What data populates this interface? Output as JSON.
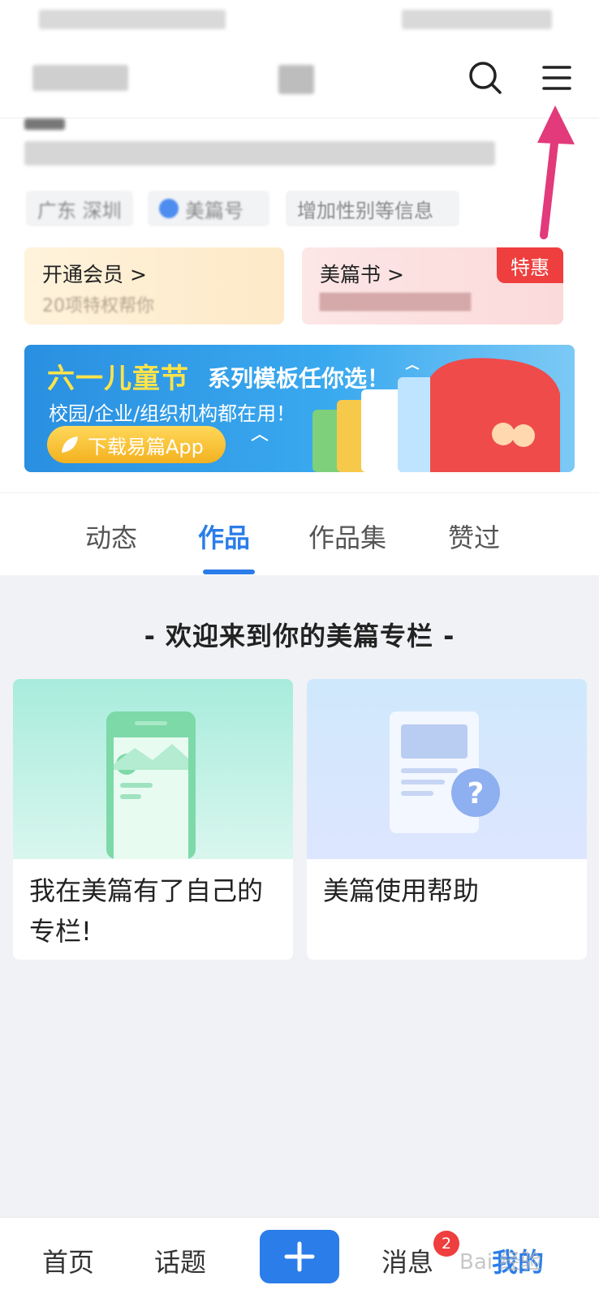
{
  "profile_card": {
    "member_title": "开通会员 >",
    "member_sub": "20项特权帮你",
    "book_title": "美篇书 >",
    "book_badge": "特惠",
    "tag_add_info": "增加性别等信息"
  },
  "banner": {
    "title": "六一儿童节",
    "title_rest": "系列模板任你选！",
    "line2": "校园/企业/组织机构都在用！",
    "button": "下载易篇App"
  },
  "tabs": [
    "动态",
    "作品",
    "作品集",
    "赞过"
  ],
  "content": {
    "welcome": "- 欢迎来到你的美篇专栏 -",
    "cards": [
      {
        "label": "我在美篇有了自己的专栏!"
      },
      {
        "label": "美篇使用帮助"
      }
    ]
  },
  "bottom_nav": {
    "home": "首页",
    "topic": "话题",
    "messages": "消息",
    "messages_badge": "2",
    "mine": "我的"
  },
  "watermark": "Bai 经验",
  "colors": {
    "accent": "#2b7de9",
    "badge_red": "#ef3e3e",
    "banner_yellow": "#ffe34a"
  }
}
